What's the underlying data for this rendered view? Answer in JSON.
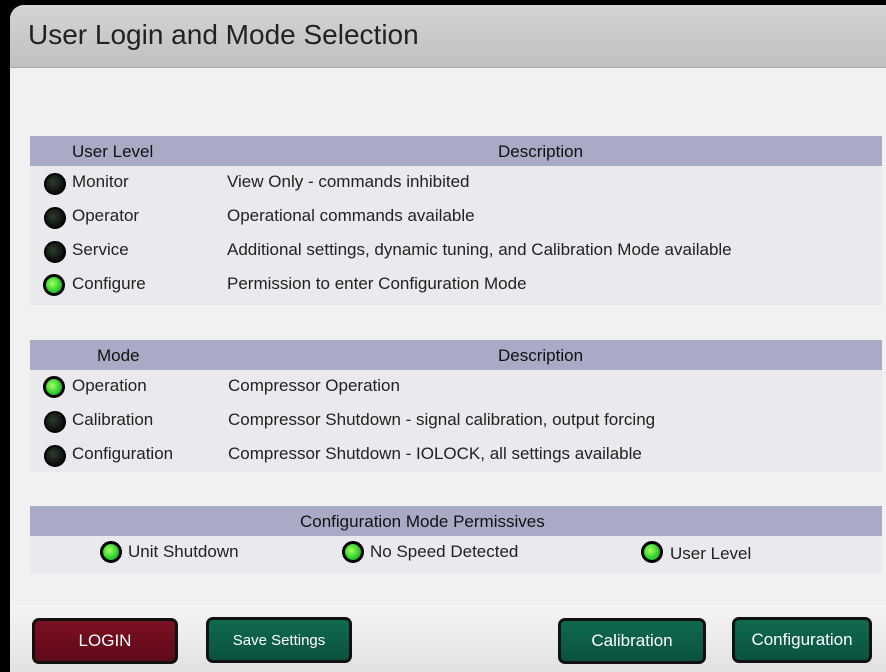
{
  "title": "User Login and Mode Selection",
  "user_level_table": {
    "header_level": "User Level",
    "header_desc": "Description",
    "rows": [
      {
        "label": "Monitor",
        "desc": "View Only - commands inhibited",
        "active": false
      },
      {
        "label": "Operator",
        "desc": "Operational commands available",
        "active": false
      },
      {
        "label": "Service",
        "desc": "Additional settings, dynamic tuning, and Calibration Mode available",
        "active": false
      },
      {
        "label": "Configure",
        "desc": "Permission to enter Configuration Mode",
        "active": true
      }
    ]
  },
  "mode_table": {
    "header_mode": "Mode",
    "header_desc": "Description",
    "rows": [
      {
        "label": "Operation",
        "desc": "Compressor Operation",
        "active": true
      },
      {
        "label": "Calibration",
        "desc": "Compressor Shutdown - signal calibration, output forcing",
        "active": false
      },
      {
        "label": "Configuration",
        "desc": "Compressor Shutdown - IOLOCK, all settings available",
        "active": false
      }
    ]
  },
  "permissives": {
    "header": "Configuration Mode Permissives",
    "items": [
      {
        "label": "Unit Shutdown",
        "active": true
      },
      {
        "label": "No Speed Detected",
        "active": true
      },
      {
        "label": "User Level",
        "active": true
      }
    ]
  },
  "buttons": {
    "login": "LOGIN",
    "save": "Save Settings",
    "calibration": "Calibration",
    "configuration": "Configuration"
  },
  "colors": {
    "header_bar": "#a9abc6",
    "led_on": "#2fd12f",
    "led_off": "#0a0f0a",
    "login_button": "#7a0f22",
    "action_button": "#0f6a50"
  }
}
